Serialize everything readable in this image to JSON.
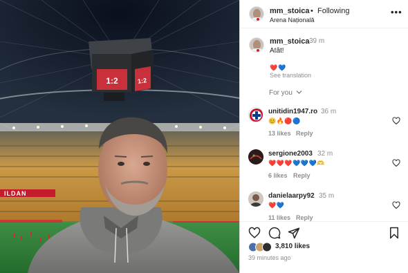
{
  "post": {
    "username": "mm_stoica",
    "separator": "•",
    "follow_state": "Following",
    "location": "Arena Națională",
    "more_icon": "more-horizontal-icon"
  },
  "caption": {
    "username": "mm_stoica",
    "time": "39 m",
    "text": "Atât!",
    "emojis": "❤️💙",
    "see_translation": "See translation"
  },
  "filter": {
    "label": "For you",
    "icon": "chevron-down-icon"
  },
  "comments": [
    {
      "username": "unitidin1947.ro",
      "time": "36 m",
      "emojis": "😊🔥🔴🔵",
      "likes": "13 likes",
      "reply": "Reply"
    },
    {
      "username": "sergione2003",
      "time": "32 m",
      "emojis": "❤️❤️❤️💙💙💙🫶",
      "likes": "6 likes",
      "reply": "Reply"
    },
    {
      "username": "danielaarpy92",
      "time": "35 m",
      "emojis": "❤️💙",
      "likes": "11 likes",
      "reply": "Reply"
    }
  ],
  "photo": {
    "scoreboard": "1:2",
    "banner": "ILDAN"
  },
  "footer": {
    "likes": "3,810 likes",
    "time_ago": "39 minutes ago"
  },
  "colors": {
    "text": "#262626",
    "secondary": "#8e8e8e",
    "border": "#dbdbdb"
  }
}
